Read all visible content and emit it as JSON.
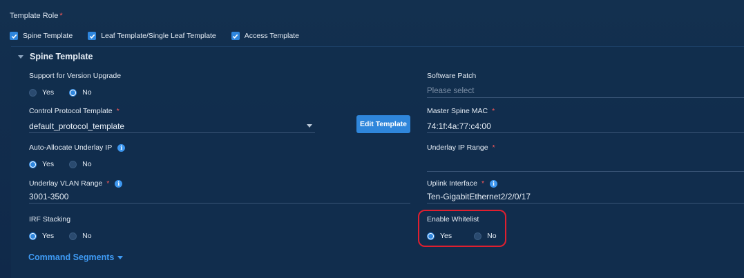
{
  "template_role": {
    "label": "Template Role",
    "required_mark": "*",
    "options": [
      {
        "label": "Spine Template",
        "checked": true
      },
      {
        "label": "Leaf Template/Single Leaf Template",
        "checked": true
      },
      {
        "label": "Access Template",
        "checked": true
      }
    ]
  },
  "spine": {
    "header": "Spine Template",
    "version_upgrade": {
      "label": "Support for Version Upgrade",
      "yes": "Yes",
      "no": "No",
      "selected": "No"
    },
    "software_patch": {
      "label": "Software Patch",
      "placeholder": "Please select"
    },
    "control_protocol": {
      "label": "Control Protocol Template",
      "required_mark": "*",
      "value": "default_protocol_template"
    },
    "edit_button": "Edit Template",
    "master_mac": {
      "label": "Master Spine MAC",
      "required_mark": "*",
      "value": "74:1f:4a:77:c4:00"
    },
    "auto_allocate": {
      "label": "Auto-Allocate Underlay IP",
      "yes": "Yes",
      "no": "No",
      "selected": "Yes"
    },
    "underlay_ip_range": {
      "label": "Underlay IP Range",
      "required_mark": "*",
      "value": ""
    },
    "underlay_vlan": {
      "label": "Underlay VLAN Range",
      "required_mark": "*",
      "value": "3001-3500"
    },
    "uplink_interface": {
      "label": "Uplink Interface",
      "required_mark": "*",
      "value": "Ten-GigabitEthernet2/2/0/17"
    },
    "irf_stacking": {
      "label": "IRF Stacking",
      "yes": "Yes",
      "no": "No",
      "selected": "Yes"
    },
    "enable_whitelist": {
      "label": "Enable Whitelist",
      "yes": "Yes",
      "no": "No",
      "selected": "Yes"
    },
    "command_segments": "Command Segments"
  },
  "colors": {
    "accent": "#2e86de",
    "highlight": "#e01f2f",
    "required": "#ff5a5a"
  }
}
